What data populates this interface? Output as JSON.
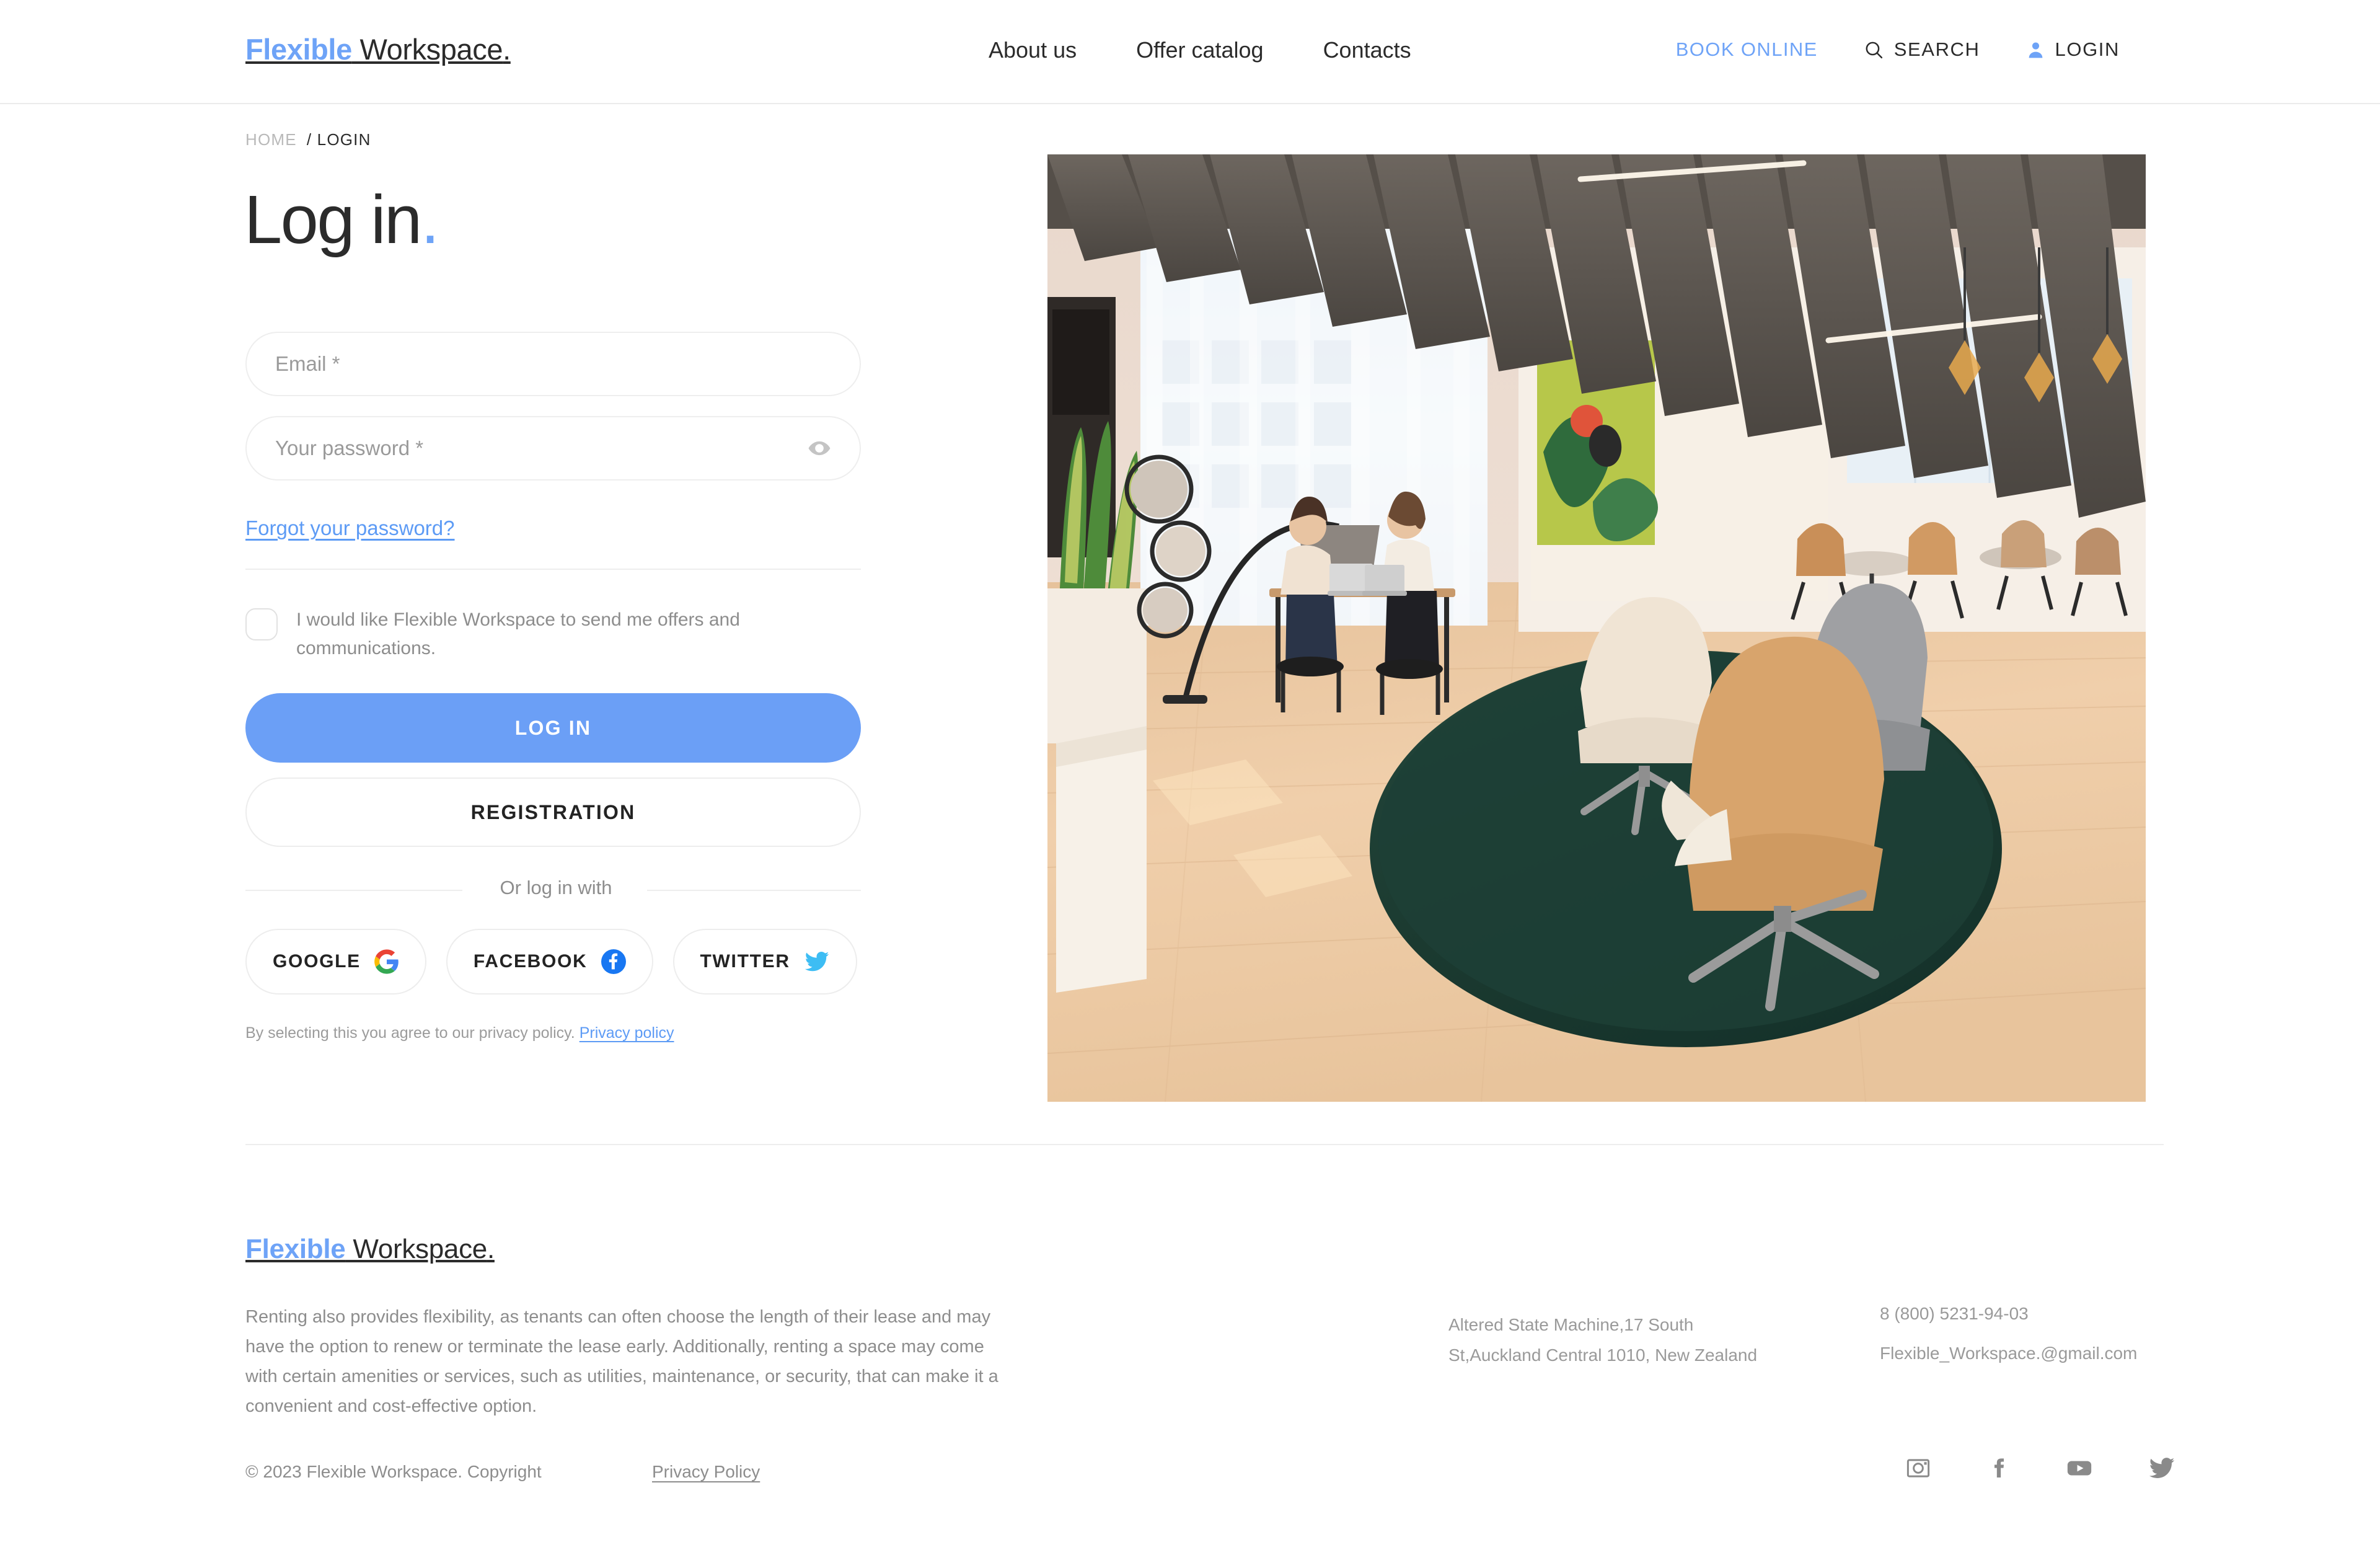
{
  "brand": {
    "accent": "#6ea3f7",
    "name_first": "Flexible",
    "name_second": " Workspace",
    "name_dot": "."
  },
  "header": {
    "nav": [
      {
        "label": "About us"
      },
      {
        "label": "Offer catalog"
      },
      {
        "label": "Contacts"
      }
    ],
    "book_online": "BOOK ONLINE",
    "search_label": "SEARCH",
    "login_label": "LOGIN"
  },
  "breadcrumb": {
    "home": "HOME",
    "current": "/ LOGIN"
  },
  "main": {
    "title": "Log in",
    "title_dot": ".",
    "email_placeholder": "Email *",
    "email_value": "",
    "password_placeholder": "Your password *",
    "password_value": "",
    "forgot_password": "Forgot your password?",
    "optin_text": "I would like Flexible Workspace to send me offers and communications.",
    "login_button": "LOG IN",
    "registration_button": "REGISTRATION",
    "or_divider": "Or log in with",
    "social_buttons": [
      {
        "label": "GOOGLE",
        "icon": "google-icon"
      },
      {
        "label": "FACEBOOK",
        "icon": "facebook-icon"
      },
      {
        "label": "TWITTER",
        "icon": "twitter-icon"
      }
    ],
    "policy_note": "By selecting this you agree to our privacy policy.",
    "policy_link": "Privacy policy"
  },
  "hero": {
    "alt": "Modern coworking office lounge with green round rug, tan swivel armchairs, people working at high tables by large curtained windows"
  },
  "footer": {
    "description": "Renting also provides flexibility, as tenants can often choose the length of their lease and may have the option to renew or terminate the lease early. Additionally, renting a space may come with certain amenities or services, such as utilities, maintenance, or security, that can make it a convenient and cost-effective option.",
    "address_line1": "Altered State Machine,17 South",
    "address_line2": "St,Auckland Central 1010, New Zealand",
    "phone": "8 (800) 5231-94-03",
    "email": "Flexible_Workspace.@gmail.com",
    "copyright": "© 2023 Flexible Workspace. Copyright",
    "privacy_policy": "Privacy Policy",
    "socials": [
      {
        "name": "instagram-icon"
      },
      {
        "name": "facebook-icon"
      },
      {
        "name": "youtube-icon"
      },
      {
        "name": "twitter-icon"
      }
    ]
  }
}
